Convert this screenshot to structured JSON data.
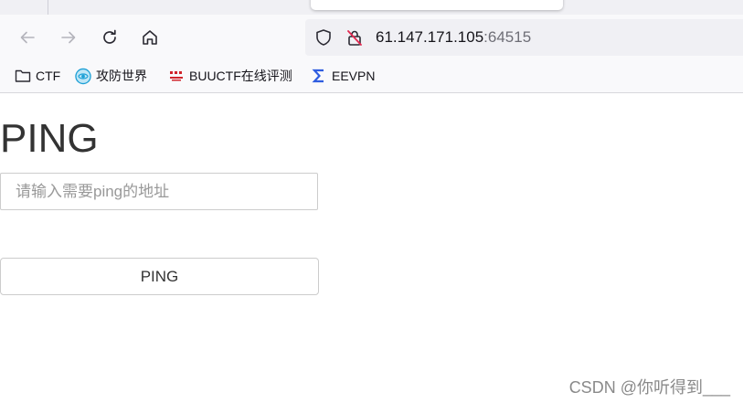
{
  "browser": {
    "address": {
      "host": "61.147.171.105",
      "port": ":64515"
    },
    "bookmarks": [
      {
        "label": "CTF",
        "icon": "folder-icon"
      },
      {
        "label": "攻防世界",
        "icon": "adworld-logo-icon"
      },
      {
        "label": "BUUCTF在线评测",
        "icon": "buuctf-logo-icon"
      },
      {
        "label": "EEVPN",
        "icon": "sigma-icon"
      }
    ]
  },
  "page": {
    "title": "PING",
    "input_placeholder": "请输入需要ping的地址",
    "button_label": "PING"
  },
  "watermark": "CSDN @你听得到___",
  "colors": {
    "chrome": "#f9f9fb",
    "urlbar": "#f0f0f4",
    "text": "#333333",
    "border": "#cccccc",
    "sigma": "#2f5de0",
    "buuctf": "#d0242b"
  }
}
